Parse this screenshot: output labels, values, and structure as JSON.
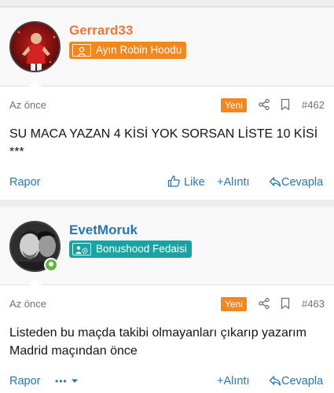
{
  "colors": {
    "accent_link": "#2577b1",
    "username_orange": "#e8793a",
    "username_blue": "#2577b1",
    "badge_orange": "#f0871f",
    "badge_teal": "#1aa3a3",
    "new_badge": "#f0871f",
    "online": "#63b341"
  },
  "posts": [
    {
      "username": "Gerrard33",
      "user_title": "Ayın Robin Hoodu",
      "user_title_icon": "user-icon",
      "time": "Az önce",
      "new_label": "Yeni",
      "post_number": "#462",
      "message_lines": [
        "SU MACA YAZAN 4 KİSİ YOK SORSAN LİSTE 10 KİSİ",
        "***"
      ],
      "actions": {
        "report": "Rapor",
        "like": "Like",
        "quote": "Alıntı",
        "reply": "Cevapla"
      }
    },
    {
      "username": "EvetMoruk",
      "user_title": "Bonushood Fedaisi",
      "user_title_icon": "users-cog-icon",
      "time": "Az önce",
      "new_label": "Yeni",
      "post_number": "#463",
      "message_lines": [
        "Listeden bu maçda takibi olmayanları çıkarıp yazarım",
        "Madrid maçından önce"
      ],
      "actions": {
        "report": "Rapor",
        "more": "•••",
        "quote": "Alıntı",
        "reply": "Cevapla"
      }
    }
  ]
}
